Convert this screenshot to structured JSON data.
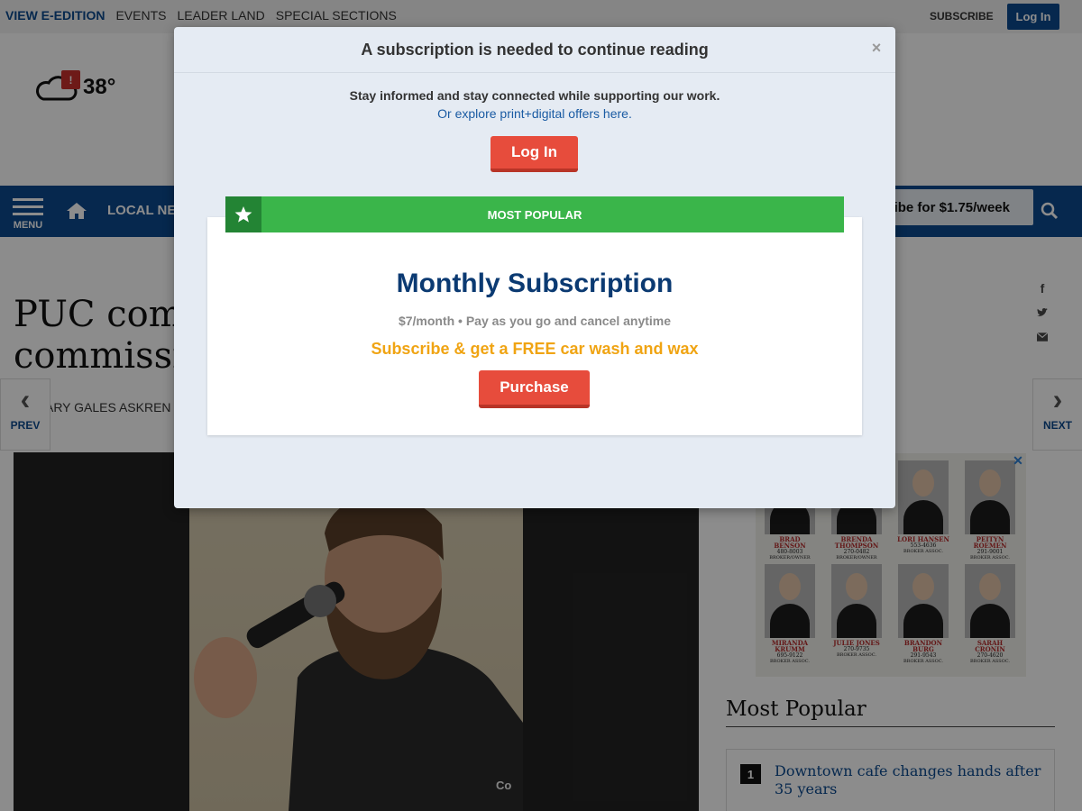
{
  "topnav": {
    "items": [
      "VIEW E-EDITION",
      "EVENTS",
      "LEADER LAND",
      "SPECIAL SECTIONS"
    ],
    "subscribe": "SUBSCRIBE",
    "login": "Log In"
  },
  "weather": {
    "temp": "38°",
    "alert": "!"
  },
  "navband": {
    "menu": "MENU",
    "local_news": "LOCAL NEWS",
    "promo": "Subscribe for $1.75/week"
  },
  "article": {
    "headline_lines": [
      "PUC commissioners",
      "commission"
    ],
    "byline": "BY MARY GALES ASKREN Staff",
    "prev": "PREV",
    "next": "NEXT",
    "photo_logo": "Co"
  },
  "ad": {
    "agents": [
      {
        "name": "BRAD BENSON",
        "phone": "480-8003",
        "role": "BROKER/OWNER"
      },
      {
        "name": "BRENDA THOMPSON",
        "phone": "270-0482",
        "role": "BROKER/OWNER"
      },
      {
        "name": "LORI HANSEN",
        "phone": "553-4636",
        "role": "BROKER ASSOC."
      },
      {
        "name": "PEITYN ROEMEN",
        "phone": "291-9001",
        "role": "BROKER ASSOC."
      },
      {
        "name": "MIRANDA KRUMM",
        "phone": "695-9122",
        "role": "BROKER ASSOC."
      },
      {
        "name": "JULIE JONES",
        "phone": "270-9735",
        "role": "BROKER ASSOC."
      },
      {
        "name": "BRANDON BURG",
        "phone": "291-9543",
        "role": "BROKER ASSOC."
      },
      {
        "name": "SARAH CRONIN",
        "phone": "270-4620",
        "role": "BROKER ASSOC."
      }
    ]
  },
  "most_popular": {
    "heading": "Most Popular",
    "items": [
      {
        "rank": "1",
        "title": "Downtown cafe changes hands after 35 years"
      }
    ]
  },
  "modal": {
    "title": "A subscription is needed to continue reading",
    "close": "×",
    "text": "Stay informed and stay connected while supporting our work.",
    "link": "Or explore print+digital offers here.",
    "login": "Log In",
    "ribbon": "MOST POPULAR",
    "plan_title": "Monthly Subscription",
    "plan_desc": "$7/month • Pay as you go and cancel anytime",
    "plan_offer": "Subscribe & get a FREE car wash and wax",
    "purchase": "Purchase"
  },
  "colors": {
    "brand": "#0b4a8f",
    "ribbon": "#3ab54a",
    "button": "#e74c3c",
    "offer": "#f0a413"
  }
}
